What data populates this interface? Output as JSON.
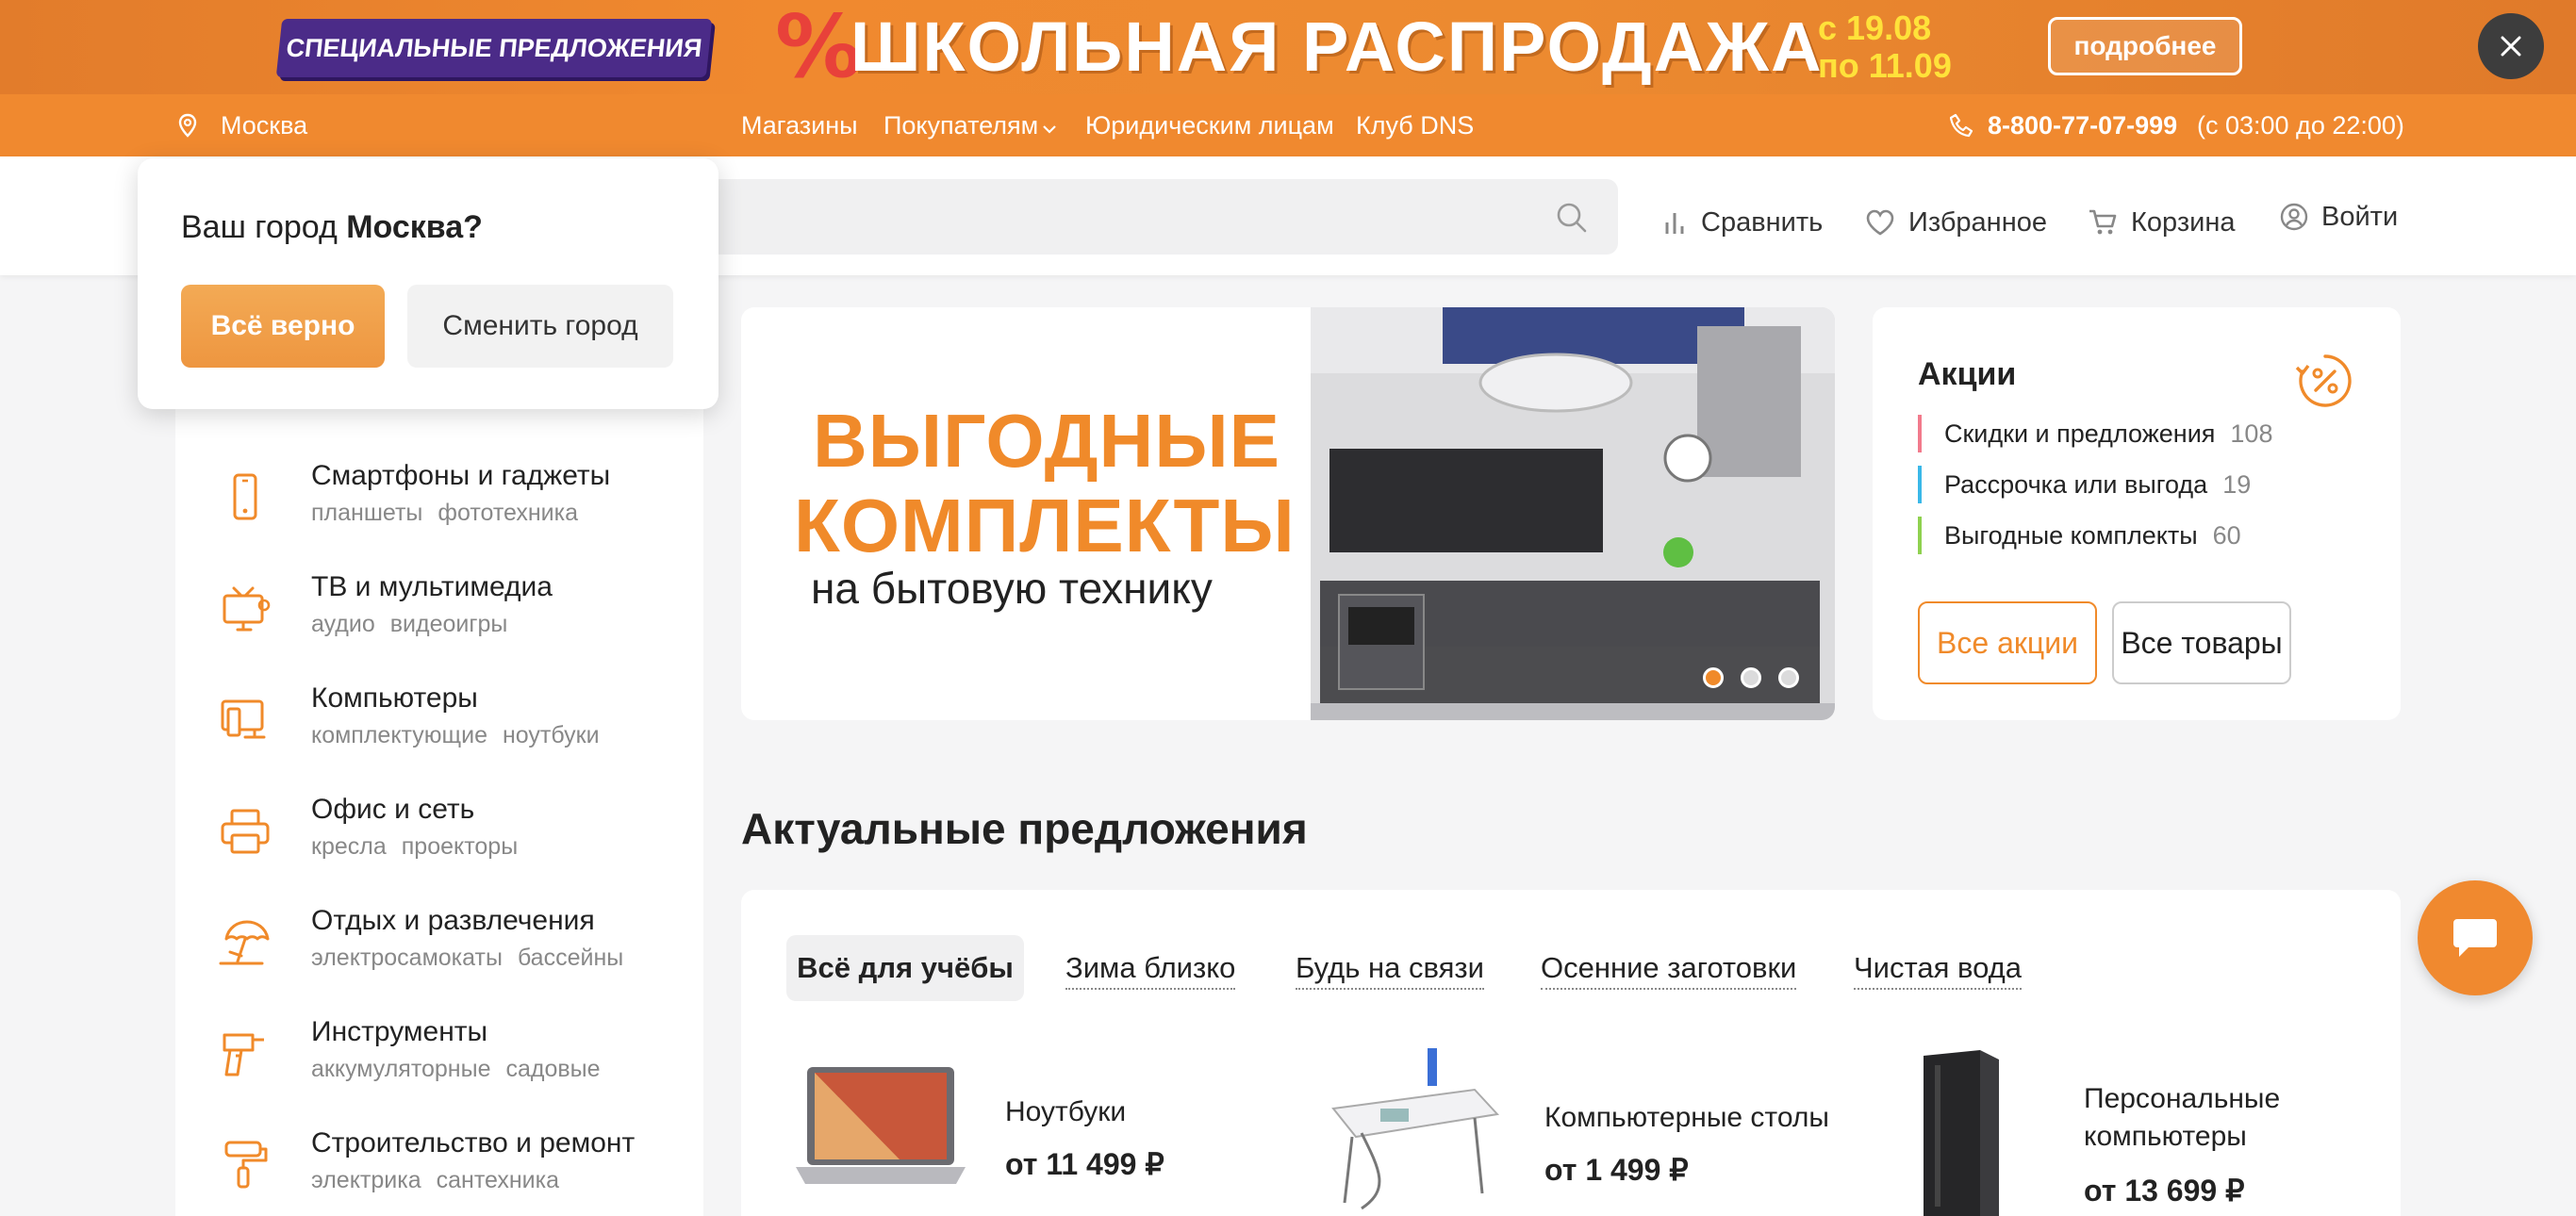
{
  "promo": {
    "special_label": "СПЕЦИАЛЬНЫЕ ПРЕДЛОЖЕНИЯ",
    "percent": "%",
    "title": "ШКОЛЬНАЯ РАСПРОДАЖА",
    "date_from": "с 19.08",
    "date_to": "по 11.09",
    "more": "подробнее",
    "close_icon": "close-icon"
  },
  "topnav": {
    "city": "Москва",
    "links": [
      "Магазины",
      "Покупателям",
      "Юридическим лицам",
      "Клуб DNS"
    ],
    "phone": "8-800-77-07-999",
    "hours": "(с 03:00 до 22:00)"
  },
  "header": {
    "compare": "Сравнить",
    "favorites": "Избранное",
    "cart": "Корзина",
    "login": "Войти"
  },
  "city_popup": {
    "question_prefix": "Ваш город ",
    "question_city": "Москва?",
    "confirm": "Всё верно",
    "change": "Сменить город"
  },
  "categories": [
    {
      "title": "Смартфоны и гаджеты",
      "subs": [
        "планшеты",
        "фототехника"
      ],
      "icon": "smartphone-icon"
    },
    {
      "title": "ТВ и мультимедиа",
      "subs": [
        "аудио",
        "видеоигры"
      ],
      "icon": "tv-icon"
    },
    {
      "title": "Компьютеры",
      "subs": [
        "комплектующие",
        "ноутбуки"
      ],
      "icon": "computer-icon"
    },
    {
      "title": "Офис и сеть",
      "subs": [
        "кресла",
        "проекторы"
      ],
      "icon": "printer-icon"
    },
    {
      "title": "Отдых и развлечения",
      "subs": [
        "электросамокаты",
        "бассейны"
      ],
      "icon": "umbrella-icon"
    },
    {
      "title": "Инструменты",
      "subs": [
        "аккумуляторные",
        "садовые"
      ],
      "icon": "drill-icon"
    },
    {
      "title": "Строительство и ремонт",
      "subs": [
        "электрика",
        "сантехника"
      ],
      "icon": "paint-roller-icon"
    }
  ],
  "hero": {
    "line1": "ВЫГОДНЫЕ",
    "line2": "КОМПЛЕКТЫ",
    "line3": "на бытовую технику"
  },
  "akcii": {
    "title": "Акции",
    "rows": [
      {
        "label": "Скидки и предложения",
        "count": "108",
        "color": "#f27a8c"
      },
      {
        "label": "Рассрочка или выгода",
        "count": "19",
        "color": "#3ab8e8"
      },
      {
        "label": "Выгодные комплекты",
        "count": "60",
        "color": "#8fd14f"
      }
    ],
    "all_akcii": "Все акции",
    "all_goods": "Все товары"
  },
  "offers": {
    "title": "Актуальные предложения",
    "tabs": [
      "Всё для учёбы",
      "Зима близко",
      "Будь на связи",
      "Осенние заготовки",
      "Чистая вода"
    ],
    "products": [
      {
        "name": "Ноутбуки",
        "price": "от 11 499 ₽"
      },
      {
        "name": "Компьютерные столы",
        "price": "от 1 499 ₽"
      },
      {
        "name": "Персональные компьютеры",
        "price": "от 13 699 ₽"
      }
    ]
  },
  "colors": {
    "accent": "#f0892f",
    "promo_purple": "#4b2b88",
    "promo_red": "#e8413a",
    "date_yellow": "#ffe23a"
  }
}
